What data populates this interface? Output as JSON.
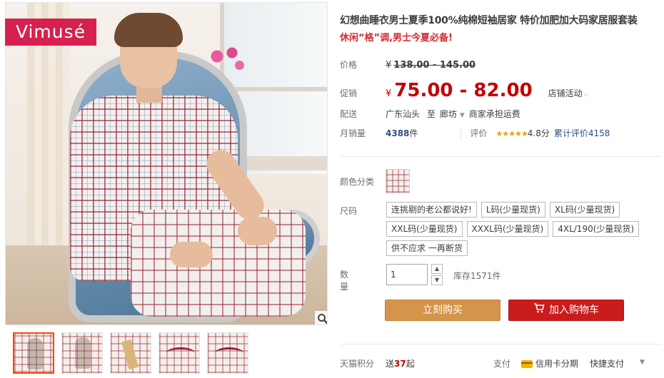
{
  "brand": {
    "logo_text": "Vimusé",
    "logo_color": "#d6214f"
  },
  "gallery": {
    "thumbnails": [
      {
        "name": "thumb-seated"
      },
      {
        "name": "thumb-standing"
      },
      {
        "name": "thumb-tag"
      },
      {
        "name": "thumb-collar"
      },
      {
        "name": "thumb-detail"
      }
    ],
    "zoom_icon": "magnifier-icon"
  },
  "product": {
    "title": "幻想曲睡衣男士夏季100%纯棉短袖居家 特价加肥加大码家居服套装",
    "subtitle": "休闲“格”调,男士今夏必备!"
  },
  "price": {
    "label": "价格",
    "currency": "¥",
    "original": "138.00 - 145.00"
  },
  "promo": {
    "label": "促销",
    "currency": "¥",
    "price": "75.00 - 82.00",
    "activity": "店铺活动",
    "price_color": "#c40000"
  },
  "shipping": {
    "label": "配送",
    "from": "广东汕头",
    "to_word": "至",
    "to": "廊坊",
    "fee": "商家承担运费"
  },
  "sales": {
    "label": "月销量",
    "count": "4388",
    "unit": "件",
    "rating_label": "评价",
    "stars": "★★★★★",
    "score": "4.8分",
    "review_text": "累计评价4158"
  },
  "color": {
    "label": "颜色分类"
  },
  "size": {
    "label": "尺码",
    "options": [
      "连挑剔的老公都说好!",
      "L码(少量现货)",
      "XL码(少量现货)",
      "XXL码(少量现货)",
      "XXXL码(少量现货)",
      "4XL/190(少量现货)",
      "供不应求 一再断货"
    ]
  },
  "quantity": {
    "label": "数量",
    "value": "1",
    "stock": "库存1571件"
  },
  "actions": {
    "buy_now": "立刻购买",
    "add_to_cart": "加入购物车",
    "buy_color": "#d4944a",
    "cart_color": "#c91c1c"
  },
  "points": {
    "label": "天猫积分",
    "prefix": "送",
    "value": "37",
    "suffix": "起"
  },
  "payment": {
    "label": "支付",
    "credit": "信用卡分期",
    "quick": "快捷支付"
  }
}
